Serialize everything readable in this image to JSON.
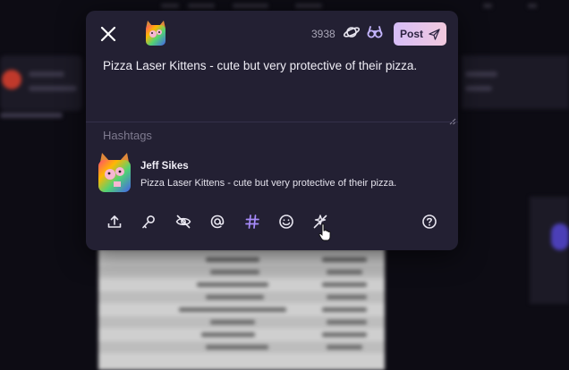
{
  "composer": {
    "character_count": "3938",
    "post_label": "Post",
    "text": "Pizza Laser Kittens - cute but very protective of their pizza.",
    "hashtags_label": "Hashtags"
  },
  "preview": {
    "author_name": "Jeff Sikes",
    "text": "Pizza Laser Kittens - cute but very protective of their pizza."
  },
  "toolbar": {
    "icons": [
      "upload-icon",
      "microphone-icon",
      "eye-off-icon",
      "mention-icon",
      "hashtag-icon",
      "emoji-icon",
      "no-ai-icon",
      "help-icon"
    ]
  },
  "colors": {
    "modal_bg": "#232033",
    "post_button_gradient_start": "#d6bdf7",
    "post_button_gradient_end": "#f2c9de",
    "accent_purple": "#a78bfa"
  }
}
